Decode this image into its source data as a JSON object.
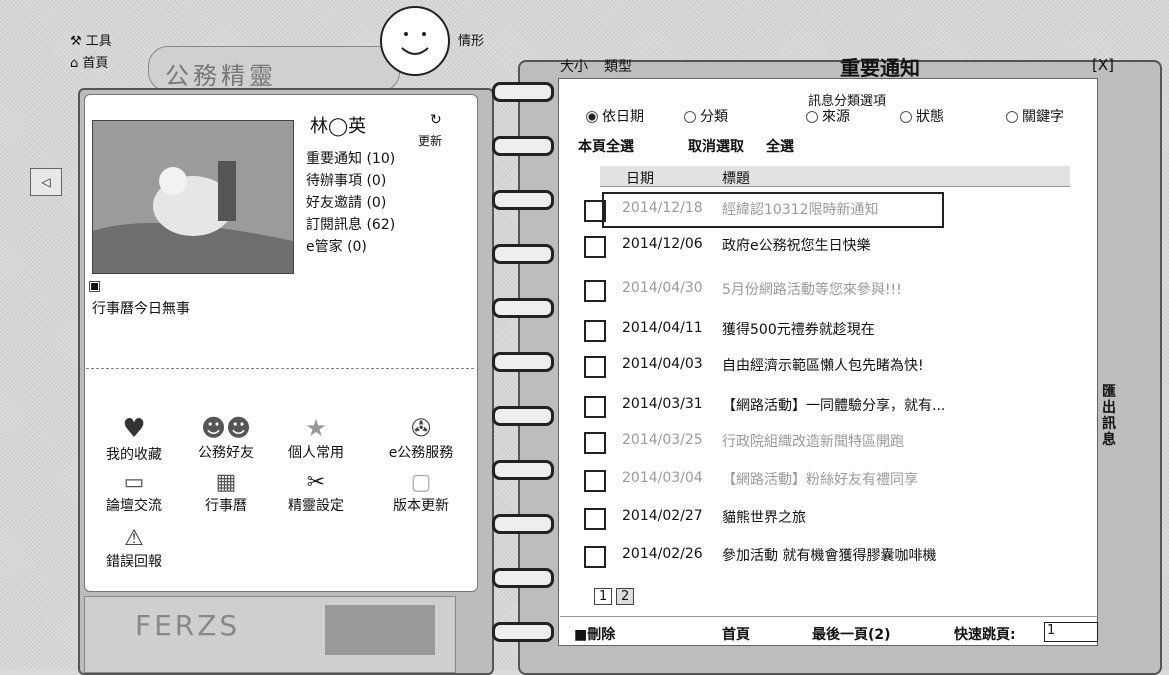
{
  "top_tabs": {
    "tools": "工具",
    "home": "首頁"
  },
  "brand": {
    "title": "公務精靈",
    "status_hint": "情形"
  },
  "profile": {
    "user_name": "林◯英",
    "refresh_label": "更新",
    "stats": [
      "重要通知 (10)",
      "待辦事項 (0)",
      "好友邀請 (0)",
      "訂閱訊息 (62)",
      "e管家 (0)"
    ],
    "calendar_text": "行事曆今日無事"
  },
  "shortcuts": [
    {
      "label": "我的收藏"
    },
    {
      "label": "公務好友"
    },
    {
      "label": "個人常用"
    },
    {
      "label": "e公務服務"
    },
    {
      "label": "論壇交流"
    },
    {
      "label": "行事曆"
    },
    {
      "label": "精靈設定"
    },
    {
      "label": "版本更新"
    },
    {
      "label": "錯誤回報"
    }
  ],
  "banner": {
    "text": "FERZS"
  },
  "panel": {
    "title": "重要通知",
    "size_label": "大小",
    "type_label": "類型",
    "close": "[X]",
    "classify_label": "訊息分類選項",
    "options": [
      "依日期",
      "分類",
      "來源",
      "狀態",
      "關鍵字"
    ],
    "selected_option": "依日期",
    "actions": {
      "select_page": "本頁全選",
      "deselect": "取消選取",
      "select_all": "全選"
    },
    "col_date": "日期",
    "col_title": "標題",
    "rows": [
      {
        "date": "2014/12/18",
        "title": "經緯認10312限時新通知",
        "read": true
      },
      {
        "date": "2014/12/06",
        "title": "政府e公務祝您生日快樂",
        "read": false
      },
      {
        "date": "2014/04/30",
        "title": "5月份網路活動等您來參與!!!",
        "read": true
      },
      {
        "date": "2014/04/11",
        "title": "獲得500元禮券就趁現在",
        "read": false
      },
      {
        "date": "2014/04/03",
        "title": "自由經濟示範區懶人包先睹為快!",
        "read": false
      },
      {
        "date": "2014/03/31",
        "title": "【網路活動】一同體驗分享，就有...",
        "read": false
      },
      {
        "date": "2014/03/25",
        "title": "行政院組織改造新聞特區開跑",
        "read": true
      },
      {
        "date": "2014/03/04",
        "title": "【網路活動】粉絲好友有禮同享",
        "read": true
      },
      {
        "date": "2014/02/27",
        "title": "貓熊世界之旅",
        "read": false
      },
      {
        "date": "2014/02/26",
        "title": "參加活動 就有機會獲得膠囊咖啡機",
        "read": false
      }
    ],
    "pages": [
      "1",
      "2"
    ],
    "export_label": "匯出訊息",
    "footer": {
      "delete": "刪除",
      "first": "首頁",
      "last": "最後一頁(2)",
      "jump": "快速跳頁:",
      "jump_value": "1"
    }
  }
}
